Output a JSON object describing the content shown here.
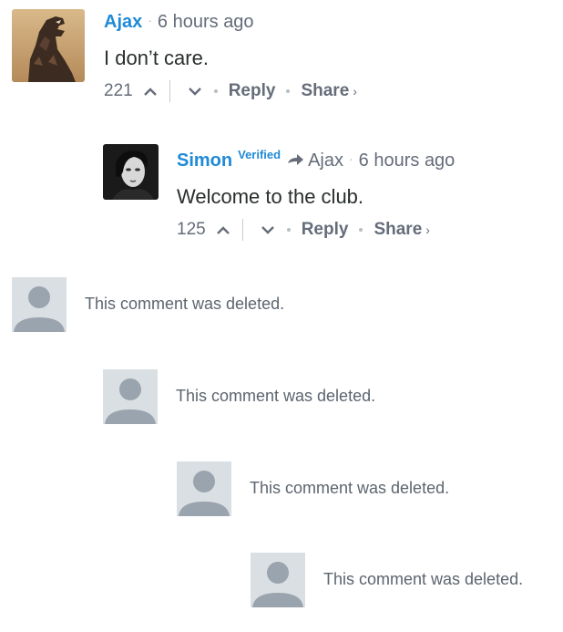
{
  "comments": [
    {
      "author": "Ajax",
      "time": "6 hours ago",
      "message": "I don’t care.",
      "votes": "221",
      "reply_label": "Reply",
      "share_label": "Share",
      "share_chevron": "›"
    },
    {
      "author": "Simon",
      "badge": "Verified",
      "in_reply_to": "Ajax",
      "time": "6 hours ago",
      "message": "Welcome to the club.",
      "votes": "125",
      "reply_label": "Reply",
      "share_label": "Share",
      "share_chevron": "›"
    }
  ],
  "deleted_comments": [
    {
      "text": "This comment was deleted."
    },
    {
      "text": "This comment was deleted."
    },
    {
      "text": "This comment was deleted."
    },
    {
      "text": "This comment was deleted."
    }
  ],
  "separator": "·",
  "colors": {
    "author": "#1f8ad6",
    "meta": "#656c7a",
    "placeholder_avatar": "#dadfe3",
    "placeholder_figure": "#9aa4ae"
  }
}
